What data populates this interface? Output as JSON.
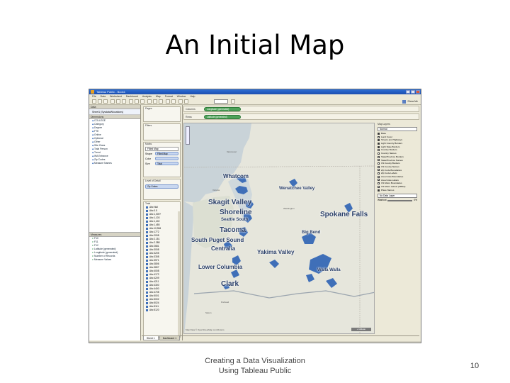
{
  "slide": {
    "title": "An Initial Map",
    "footer_line1": "Creating a Data Visualization",
    "footer_line2": "Using Tableau Public",
    "page_number": "10"
  },
  "window": {
    "title": "Tableau Public - Book1",
    "menu": [
      "File",
      "Data",
      "Worksheet",
      "Dashboard",
      "Analysis",
      "Map",
      "Format",
      "Window",
      "Help"
    ],
    "show_me": "Show Me"
  },
  "data_pane": {
    "header": "Data",
    "datasource": "Sheet1 (SysdataWlocations)",
    "dimensions_header": "Dimensions",
    "dimensions": [
      "COLLEGE",
      "Category",
      "Degree",
      "FTE",
      "Online",
      "Optional",
      "Other",
      "Site Class",
      "Total Person",
      "Trend",
      "WA Entrance",
      "Zip Codes",
      "Measure Names"
    ],
    "measures_header": "Measures",
    "measures": [
      "F10",
      "F11",
      "F12",
      "Latitude (generated)",
      "Longitude (generated)",
      "Number of Records",
      "Measure Values"
    ]
  },
  "shelf_col": {
    "pages": "Pages",
    "filters": "Filters",
    "marks": "Marks",
    "mark_type": "Filled Map",
    "shape_label": "Shape",
    "shape_value": "Filled Map",
    "color_label": "Color",
    "color_value": "",
    "size_label": "Size",
    "size_value": "Total",
    "lod": "Level of Detail",
    "lod_pill": "Zip Codes",
    "legend_title": "Total",
    "legend_items": [
      "Abc Null",
      "Abc 0.5",
      "Abc 1,000+",
      "Abc 1,103",
      "Abc 1,402",
      "Abc 1,455",
      "Abc 10,984",
      "Abc 1772",
      "Abc 2008",
      "Abc 2.151",
      "Abc 2.388",
      "Abc 2681",
      "Abc 3008",
      "Abc 3205",
      "Abc 3308",
      "Abc 3571",
      "Abc 3806",
      "Abc 3807",
      "Abc 4008",
      "Abc 4172",
      "Abc 4209",
      "Abc 4211",
      "Abc 4300",
      "Abc 4400",
      "Abc 4708",
      "Abc 5001",
      "Abc 5002",
      "Abc 5024",
      "Abc 5111",
      "Abc 5120"
    ]
  },
  "shelves": {
    "columns_label": "Columns",
    "columns_pill": "Longitude (generated)",
    "rows_label": "Rows",
    "rows_pill": "Latitude (generated)"
  },
  "map": {
    "regions": {
      "skagit": "Skagit Valley",
      "whatcom": "Whatcom",
      "wenatchee": "Wenatchee Valley",
      "shoreline": "Shoreline",
      "seattle_south": "Seattle South",
      "spokane": "Spokane Falls",
      "tacoma": "Tacoma",
      "big_bend": "Big Bend",
      "south_puget": "South Puget Sound",
      "centralia": "Centralia",
      "yakima": "Yakima Valley",
      "lower_columbia": "Lower Columbia",
      "walla_walla": "Walla Walla",
      "clark": "Clark"
    },
    "cities": {
      "vancouver": "Vancouver",
      "victoria": "Victoria",
      "washington": "Washington",
      "olympia": "Olympia",
      "salem": "Salem",
      "portland": "Portland"
    },
    "credit": "Map Data © OpenStreetMap contributors",
    "badge": "+ tableau"
  },
  "layers_pane": {
    "title": "Map Layers",
    "style_value": "Normal",
    "layers": [
      {
        "label": "Base",
        "on": true
      },
      {
        "label": "Land Cover",
        "on": false
      },
      {
        "label": "Streets and Highways",
        "on": true
      },
      {
        "label": "Light Country Borders",
        "on": true
      },
      {
        "label": "Light State Borders",
        "on": true
      },
      {
        "label": "Country Borders",
        "on": false
      },
      {
        "label": "Country Names",
        "on": false
      },
      {
        "label": "State/Province Borders",
        "on": false
      },
      {
        "label": "State/Province Names",
        "on": false
      },
      {
        "label": "US County Borders",
        "on": false
      },
      {
        "label": "US County Names",
        "on": false
      },
      {
        "label": "Zip Code Boundaries",
        "on": false
      },
      {
        "label": "Zip Code Labels",
        "on": false
      },
      {
        "label": "Area Code Boundaries",
        "on": false
      },
      {
        "label": "Area Code Labels",
        "on": false
      },
      {
        "label": "US Metro Boundaries",
        "on": false
      },
      {
        "label": "US Metro Labels (CBSA)",
        "on": false
      },
      {
        "label": "Place Names",
        "on": true
      }
    ],
    "data_layer": "No Data Layer",
    "washout_label": "Washout",
    "washout_value": "0%"
  },
  "tabs": [
    "Sheet 1",
    "Dashboard 1"
  ]
}
